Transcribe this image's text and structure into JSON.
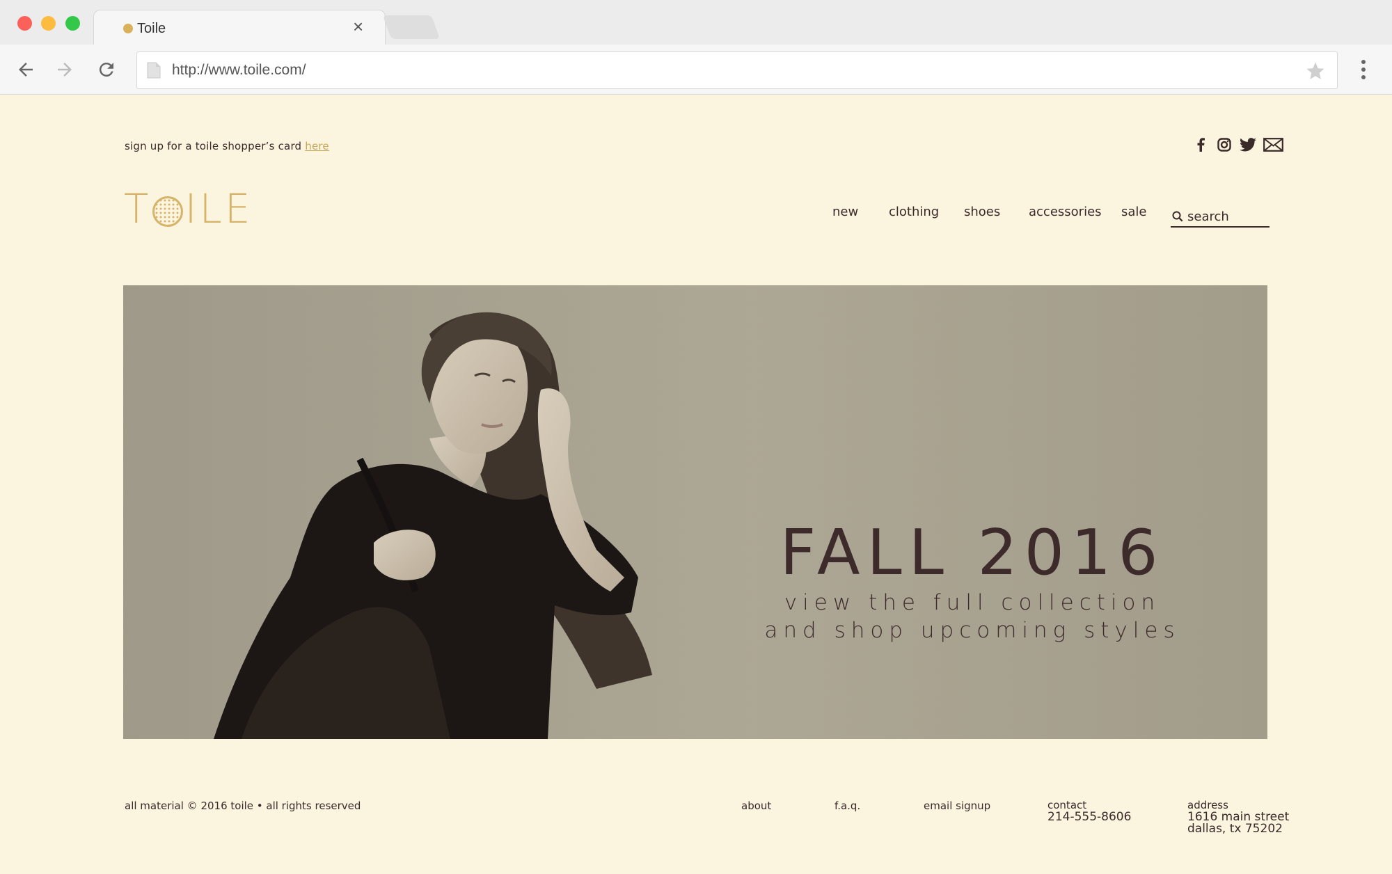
{
  "browser": {
    "tab_title": "Toile",
    "url": "http://www.toile.com/"
  },
  "header": {
    "signup_text": "sign up for a toile shopper’s card",
    "signup_link": "here",
    "logo": "TOILE",
    "social_icons": [
      "facebook-icon",
      "instagram-icon",
      "twitter-icon",
      "mail-icon"
    ]
  },
  "nav": {
    "items": [
      "new",
      "clothing",
      "shoes",
      "accessories",
      "sale"
    ],
    "search_placeholder": "search"
  },
  "hero": {
    "title": "FALL 2016",
    "subtitle_line1": "view the full collection",
    "subtitle_line2": "and shop upcoming styles"
  },
  "footer": {
    "copyright": "all material © 2016 toile • all rights reserved",
    "links": [
      "about",
      "f.a.q.",
      "email signup"
    ],
    "contact_label": "contact",
    "contact_phone": "214-555-8606",
    "address_label": "address",
    "address_line1": "1616 main street",
    "address_line2": "dallas, tx 75202"
  },
  "colors": {
    "page_bg": "#fbf4df",
    "accent_gold": "#d5b46a",
    "text_dark": "#3a2a2a"
  }
}
